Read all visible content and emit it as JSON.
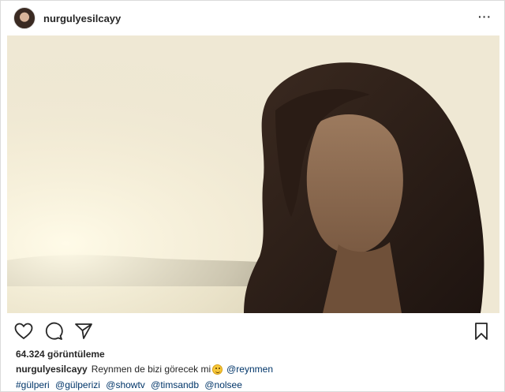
{
  "header": {
    "username": "nurgulyesilcayy",
    "more_label": "···"
  },
  "media": {
    "avatar_icon": "profile-avatar",
    "image_description_icon": "video-frame-icon"
  },
  "actions": {
    "like_icon": "heart-icon",
    "comment_icon": "comment-icon",
    "share_icon": "send-icon",
    "save_icon": "bookmark-icon"
  },
  "stats": {
    "views": "64.324 görüntüleme"
  },
  "caption": {
    "username": "nurgulyesilcayy",
    "text": "Reynmen de bizi görecek mi",
    "mention": "@reynmen",
    "hashtags": [
      "#gülperi",
      "@gülperizi",
      "@showtv",
      "@timsandb",
      "@nolsee"
    ]
  },
  "colors": {
    "text": "#262626",
    "link": "#003569",
    "border": "#dbdbdb"
  }
}
